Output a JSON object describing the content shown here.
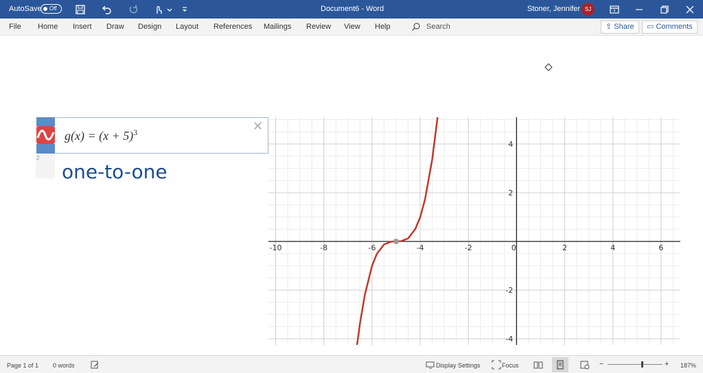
{
  "titlebar": {
    "autosave_label": "AutoSave",
    "autosave_state": "Off",
    "document_title": "Document6 - Word",
    "user_name": "Stoner, Jennifer L",
    "user_initials": "SJ"
  },
  "ribbon": {
    "tabs": [
      "File",
      "Home",
      "Insert",
      "Draw",
      "Design",
      "Layout",
      "References",
      "Mailings",
      "Review",
      "View",
      "Help"
    ],
    "search_label": "Search",
    "share_label": "Share",
    "comments_label": "Comments"
  },
  "equation": {
    "prefix": "g(x) = (x + 5)",
    "exponent": "3",
    "row_number": "2",
    "handwritten_note": "one-to-one"
  },
  "chart_data": {
    "type": "line",
    "function": "g(x) = (x + 5)^3",
    "xlim": [
      -10.3,
      6.8
    ],
    "ylim": [
      -4.25,
      5.1
    ],
    "x_ticks": [
      -10,
      -8,
      -6,
      -4,
      -2,
      0,
      2,
      4,
      6
    ],
    "y_ticks": [
      -4,
      -2,
      2,
      4
    ],
    "grid": true,
    "series": [
      {
        "x": [
          -6.62,
          -6.5,
          -6.3,
          -6.0,
          -5.8,
          -5.5,
          -5.2,
          -5.0,
          -4.8,
          -4.5,
          -4.2,
          -4.0,
          -3.8,
          -3.5,
          -3.27
        ],
        "y": [
          -4.25,
          -3.375,
          -2.197,
          -1.0,
          -0.512,
          -0.125,
          -0.008,
          0.0,
          0.008,
          0.125,
          0.512,
          1.0,
          1.728,
          3.375,
          5.18
        ],
        "color": "#c0392b"
      }
    ],
    "highlight_point": {
      "x": -5,
      "y": 0
    }
  },
  "statusbar": {
    "page": "Page 1 of 1",
    "words": "0 words",
    "display_settings": "Display Settings",
    "focus": "Focus",
    "zoom_minus": "−",
    "zoom_plus": "+",
    "zoom_value": "187%",
    "zoom_level": 0.62
  }
}
